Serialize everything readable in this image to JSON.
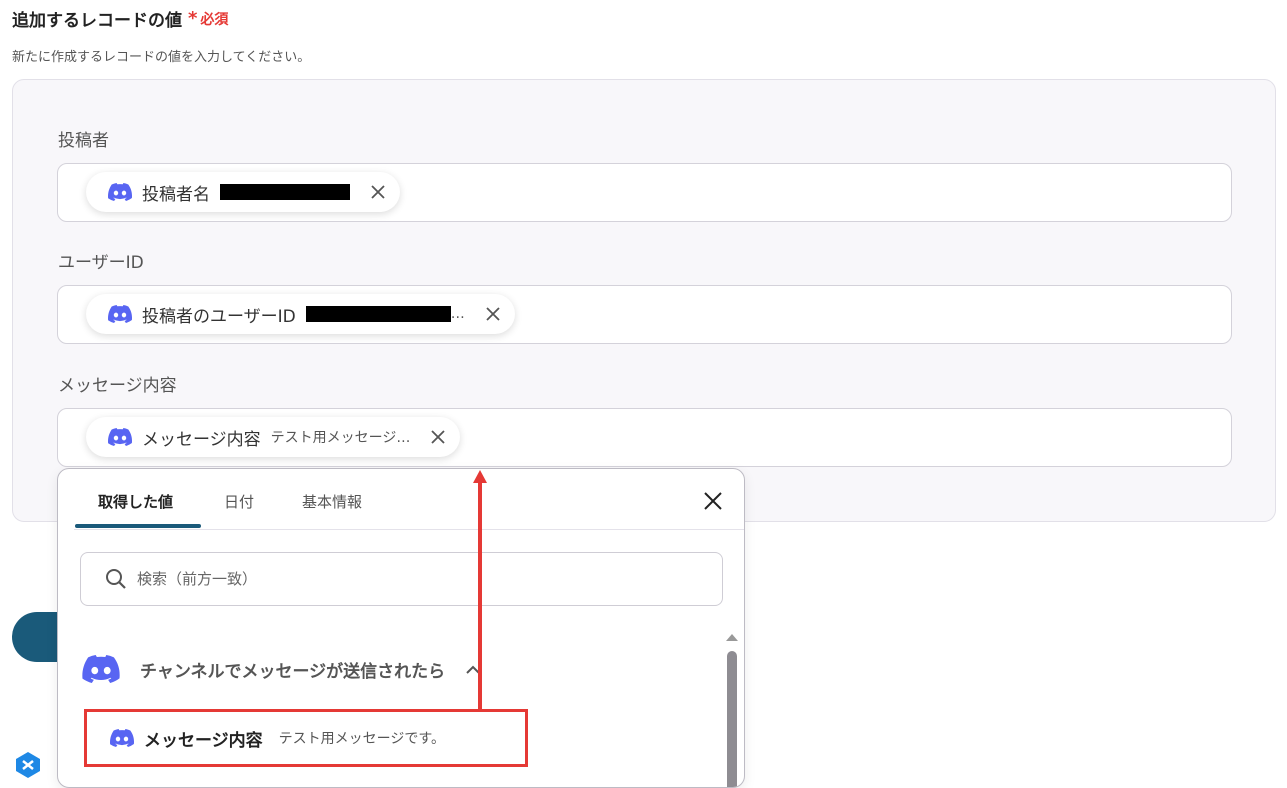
{
  "section": {
    "title": "追加するレコードの値",
    "required_star": "*",
    "required_label": "必須",
    "description": "新たに作成するレコードの値を入力してください。"
  },
  "fields": [
    {
      "label": "投稿者",
      "chip_name": "投稿者名",
      "chip_value": "",
      "chip_icon": "discord-icon"
    },
    {
      "label": "ユーザーID",
      "chip_name": "投稿者のユーザーID",
      "chip_value": "…",
      "chip_icon": "discord-icon"
    },
    {
      "label": "メッセージ内容",
      "chip_name": "メッセージ内容",
      "chip_value": "テスト用メッセージ…",
      "chip_icon": "discord-icon"
    }
  ],
  "dropdown": {
    "tabs": [
      {
        "label": "取得した値",
        "active": true
      },
      {
        "label": "日付",
        "active": false
      },
      {
        "label": "基本情報",
        "active": false
      }
    ],
    "search_placeholder": "検索（前方一致）",
    "group": {
      "title": "チャンネルでメッセージが送信されたら",
      "icon": "discord-icon",
      "expanded": true
    },
    "items": [
      {
        "name": "メッセージ内容",
        "value": "テスト用メッセージです。",
        "highlighted": true
      }
    ]
  },
  "colors": {
    "accent": "#1a5a7a",
    "required": "#e53935",
    "discord": "#5865F2",
    "highlight": "#e53935"
  }
}
